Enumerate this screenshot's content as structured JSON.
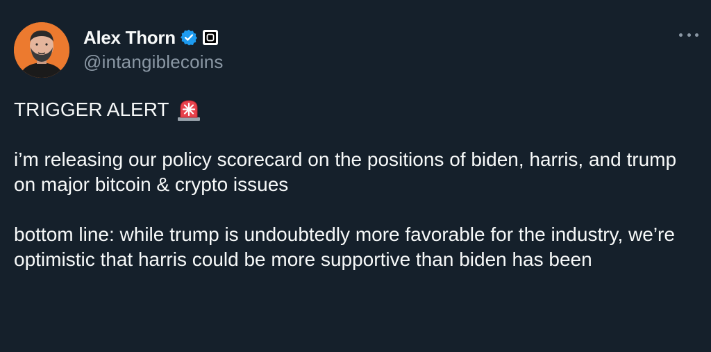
{
  "author": {
    "display_name": "Alex Thorn",
    "handle": "@intangiblecoins",
    "avatar_icon": "avatar-image",
    "verified_icon": "verified-badge-icon",
    "affiliate_icon": "affiliate-badge-icon"
  },
  "tweet": {
    "line1": "TRIGGER ALERT",
    "alert_icon": "police-light-emoji",
    "paragraph2": "i’m releasing our policy scorecard on the positions of biden, harris, and trump on major bitcoin & crypto issues",
    "paragraph3": "bottom line: while trump is undoubtedly more favorable for the industry, we’re optimistic that harris could be more supportive than biden has been"
  },
  "menu": {
    "icon": "more-options-icon"
  },
  "colors": {
    "background": "#15202b",
    "text": "#f7f9f9",
    "secondary": "#8b98a5",
    "verified": "#1d9bf0",
    "avatar_bg": "#ec7a2f"
  }
}
